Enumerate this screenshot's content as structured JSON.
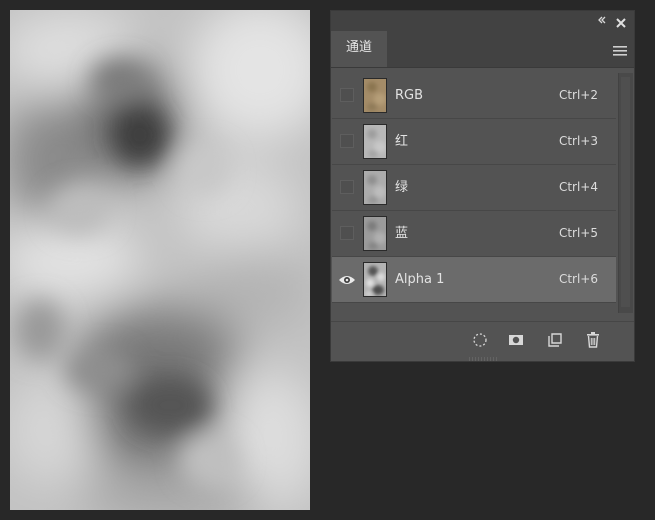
{
  "panel": {
    "tab_label": "通道",
    "icons": {
      "collapse": "double-chevron-icon",
      "close": "close-icon",
      "menu": "panel-menu-icon"
    }
  },
  "channels": [
    {
      "name": "RGB",
      "shortcut": "Ctrl+2",
      "visible": false,
      "selected": false
    },
    {
      "name": "红",
      "shortcut": "Ctrl+3",
      "visible": false,
      "selected": false
    },
    {
      "name": "绿",
      "shortcut": "Ctrl+4",
      "visible": false,
      "selected": false
    },
    {
      "name": "蓝",
      "shortcut": "Ctrl+5",
      "visible": false,
      "selected": false
    },
    {
      "name": "Alpha 1",
      "shortcut": "Ctrl+6",
      "visible": true,
      "selected": true
    }
  ],
  "footer": {
    "icons": [
      "load-selection-icon",
      "save-selection-mask-icon",
      "new-channel-icon",
      "delete-channel-icon"
    ]
  },
  "colors": {
    "background": "#282828",
    "panel": "#535353",
    "selected_row": "#6b6b6b",
    "rgb_thumb": "#a08a68"
  }
}
